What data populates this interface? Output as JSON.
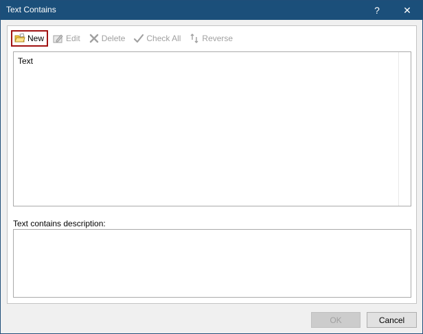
{
  "window": {
    "title": "Text Contains",
    "help_label": "?",
    "close_label": "✕"
  },
  "toolbar": {
    "new_label": "New",
    "edit_label": "Edit",
    "delete_label": "Delete",
    "check_all_label": "Check All",
    "reverse_label": "Reverse"
  },
  "list": {
    "items": [
      "Text"
    ]
  },
  "description": {
    "label": "Text contains description:",
    "value": ""
  },
  "buttons": {
    "ok_label": "OK",
    "cancel_label": "Cancel"
  }
}
